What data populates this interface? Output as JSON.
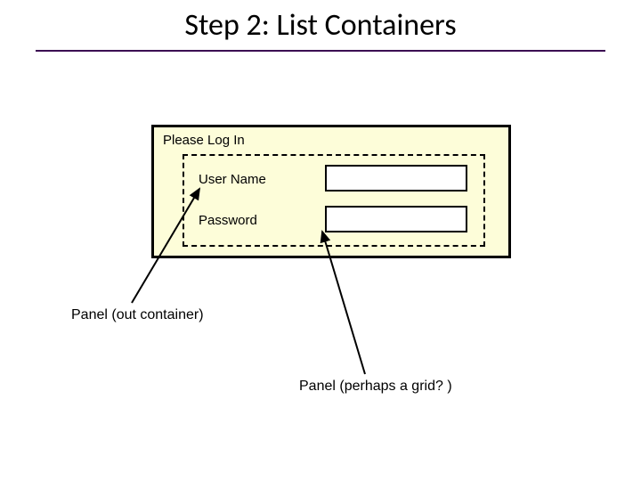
{
  "title": "Step 2: List Containers",
  "panel": {
    "heading": "Please Log In",
    "row1_label": "User Name",
    "row2_label": "Password"
  },
  "captions": {
    "outer": "Panel (out container)",
    "inner": "Panel (perhaps a grid? )"
  },
  "colors": {
    "underline": "#3b0a52",
    "panel_fill": "#fdfdd9"
  }
}
